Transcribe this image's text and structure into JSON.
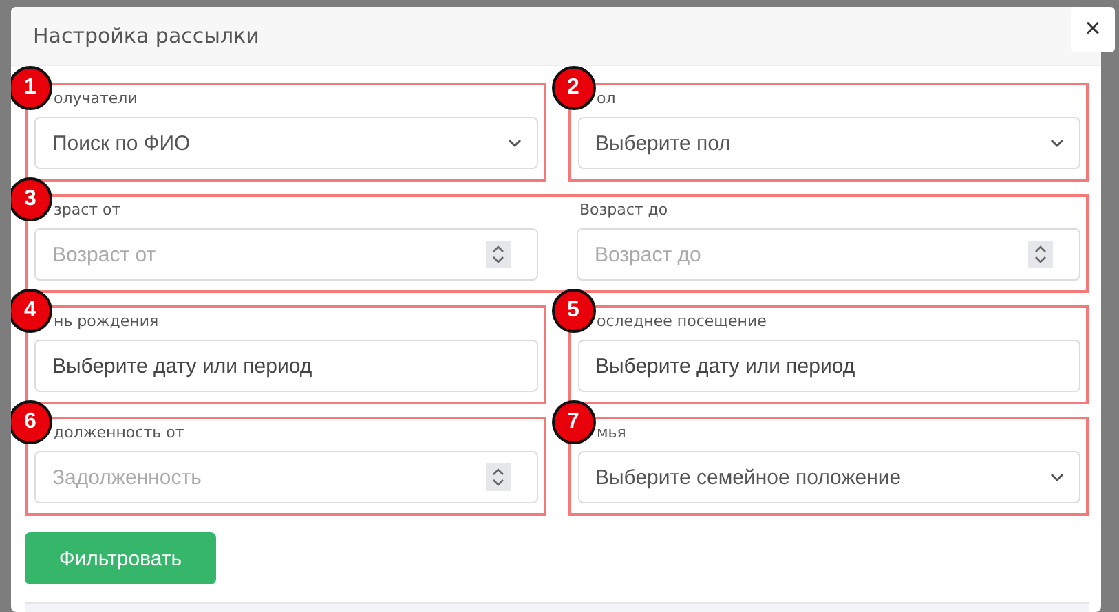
{
  "dialog": {
    "title": "Настройка рассылки",
    "close": "×"
  },
  "groups": [
    {
      "marker": "1",
      "fields": [
        {
          "kind": "select",
          "label": "олучатели",
          "value": "Поиск по ФИО"
        }
      ]
    },
    {
      "marker": "2",
      "fields": [
        {
          "kind": "select",
          "label": "ол",
          "value": "Выберите пол"
        }
      ]
    },
    {
      "marker": "3",
      "fields": [
        {
          "kind": "number",
          "label": "зраст от",
          "placeholder": "Возраст от"
        },
        {
          "kind": "number",
          "label": "Возраст до",
          "placeholder": "Возраст до"
        }
      ]
    },
    {
      "marker": "4",
      "fields": [
        {
          "kind": "date",
          "label": "нь рождения",
          "placeholder": "Выберите дату или период"
        }
      ]
    },
    {
      "marker": "5",
      "fields": [
        {
          "kind": "date",
          "label": "оследнее посещение",
          "placeholder": "Выберите дату или период"
        }
      ]
    },
    {
      "marker": "6",
      "fields": [
        {
          "kind": "number",
          "label": "долженность от",
          "placeholder": "Задолженность"
        }
      ]
    },
    {
      "marker": "7",
      "fields": [
        {
          "kind": "select",
          "label": "мья",
          "value": "Выберите семейное положение"
        }
      ]
    }
  ],
  "submit": "Фильтровать"
}
